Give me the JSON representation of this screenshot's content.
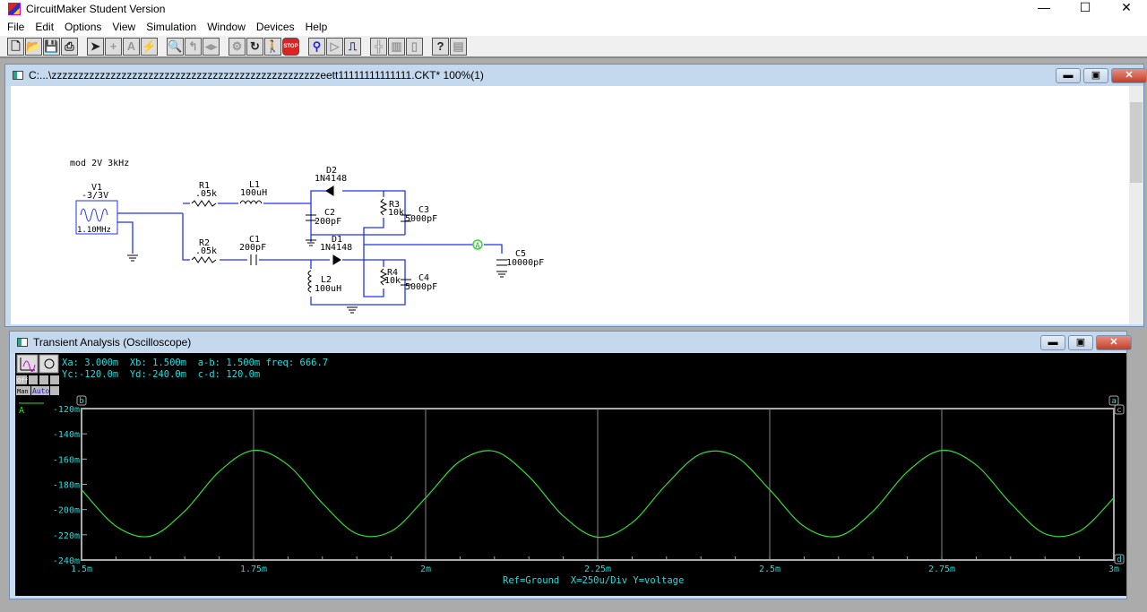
{
  "app": {
    "title": "CircuitMaker Student Version"
  },
  "menu": [
    "File",
    "Edit",
    "Options",
    "View",
    "Simulation",
    "Window",
    "Devices",
    "Help"
  ],
  "toolbar": [
    {
      "icon": "new-file-icon",
      "glyph": "🗋"
    },
    {
      "icon": "open-folder-icon",
      "glyph": "📂"
    },
    {
      "icon": "save-icon",
      "glyph": "💾"
    },
    {
      "icon": "print-icon",
      "glyph": "⎙"
    },
    {
      "icon": "arrow-tool-icon",
      "glyph": "➤"
    },
    {
      "icon": "wire-tool-icon",
      "glyph": "+",
      "dis": true
    },
    {
      "icon": "text-tool-icon",
      "glyph": "A",
      "dis": true
    },
    {
      "icon": "probe-tool-icon",
      "glyph": "⚡",
      "dis": true
    },
    {
      "icon": "zoom-icon",
      "glyph": "🔍"
    },
    {
      "icon": "rotate-icon",
      "glyph": "↰",
      "dis": true
    },
    {
      "icon": "mirror-icon",
      "glyph": "◂▸",
      "dis": true
    },
    {
      "icon": "digital-sim-icon",
      "glyph": "⚙",
      "dis": true
    },
    {
      "icon": "reset-icon",
      "glyph": "↻"
    },
    {
      "icon": "step-icon",
      "glyph": "🚶",
      "dis": true
    },
    {
      "icon": "stop-icon",
      "glyph": "STOP",
      "stop": true
    },
    {
      "icon": "analog-probe-icon",
      "glyph": "⚲",
      "blue": true
    },
    {
      "icon": "trace-icon",
      "glyph": "▷",
      "dis": true
    },
    {
      "icon": "waveform-icon",
      "glyph": "⎍",
      "blue": true
    },
    {
      "icon": "netlist-icon",
      "glyph": "╬",
      "dis": true
    },
    {
      "icon": "device-icon",
      "glyph": "▥",
      "dis": true
    },
    {
      "icon": "ic-icon",
      "glyph": "▯",
      "dis": true
    },
    {
      "icon": "help-icon",
      "glyph": "?"
    },
    {
      "icon": "help-topics-icon",
      "glyph": "▤",
      "dis": true
    }
  ],
  "circuit_window": {
    "title": "C:...\\zzzzzzzzzzzzzzzzzzzzzzzzzzzzzzzzzzzzzzzzzzzzzzzzzzeett11111111111111.CKT* 100%(1)"
  },
  "schematic": {
    "note": "mod 2V 3kHz",
    "V1": {
      "name": "V1",
      "value": "-3/3V",
      "freq": "1.10MHz"
    },
    "R1": {
      "name": "R1",
      "value": ".05k"
    },
    "L1": {
      "name": "L1",
      "value": "100uH"
    },
    "R2": {
      "name": "R2",
      "value": ".05k"
    },
    "C1": {
      "name": "C1",
      "value": "200pF"
    },
    "D2": {
      "name": "D2",
      "value": "1N4148"
    },
    "D1": {
      "name": "D1",
      "value": "1N4148"
    },
    "C2": {
      "name": "C2",
      "value": "200pF"
    },
    "L2": {
      "name": "L2",
      "value": "100uH"
    },
    "R3": {
      "name": "R3",
      "value": "10k"
    },
    "C3": {
      "name": "C3",
      "value": "5000pF"
    },
    "R4": {
      "name": "R4",
      "value": "10k"
    },
    "C4": {
      "name": "C4",
      "value": "5000pF"
    },
    "C5": {
      "name": "C5",
      "value": "10000pF"
    },
    "probe": "A"
  },
  "scope_window": {
    "title": "Transient Analysis (Oscilloscope)",
    "readout1": "Xa: 3.000m  Xb: 1.500m  a-b: 1.500m freq: 666.7",
    "readout2": "Yc:-120.0m  Yd:-240.0m  c-d: 120.0m",
    "off_label": "Off",
    "man_label": "Man",
    "auto_label": "Auto",
    "footer": "Ref=Ground  X=250u/Div Y=voltage",
    "cursors": [
      "b",
      "a",
      "c",
      "d"
    ]
  },
  "chart_data": {
    "type": "line",
    "xlim": [
      1.5,
      3.0
    ],
    "ylim": [
      -240,
      -120
    ],
    "x_unit": "ms",
    "y_unit": "mV",
    "x_ticks": [
      "1.5m",
      "1.75m",
      "2m",
      "2.25m",
      "2.5m",
      "2.75m",
      "3m"
    ],
    "y_ticks": [
      "-120m",
      "-140m",
      "-160m",
      "-180m",
      "-200m",
      "-220m",
      "-240m"
    ],
    "grid": true,
    "color": "#33dd33",
    "series": [
      {
        "name": "A",
        "x": [
          1.5,
          1.55,
          1.6,
          1.65,
          1.7,
          1.75,
          1.8,
          1.85,
          1.9,
          1.95,
          2.0,
          2.05,
          2.1,
          2.15,
          2.2,
          2.25,
          2.3,
          2.35,
          2.4,
          2.45,
          2.5,
          2.55,
          2.6,
          2.65,
          2.7,
          2.75,
          2.8,
          2.85,
          2.9,
          2.95,
          3.0
        ],
        "y": [
          -184.2,
          -213.1,
          -221.1,
          -201.2,
          -169.9,
          -153.1,
          -164.7,
          -195.0,
          -219.2,
          -217.2,
          -190.7,
          -161.6,
          -153.8,
          -173.8,
          -205.1,
          -221.9,
          -210.4,
          -180.0,
          -155.8,
          -157.8,
          -184.3,
          -213.4,
          -221.1,
          -201.4,
          -170.0,
          -153.1,
          -164.7,
          -195.0,
          -219.2,
          -217.2,
          -190.7
        ]
      }
    ]
  }
}
